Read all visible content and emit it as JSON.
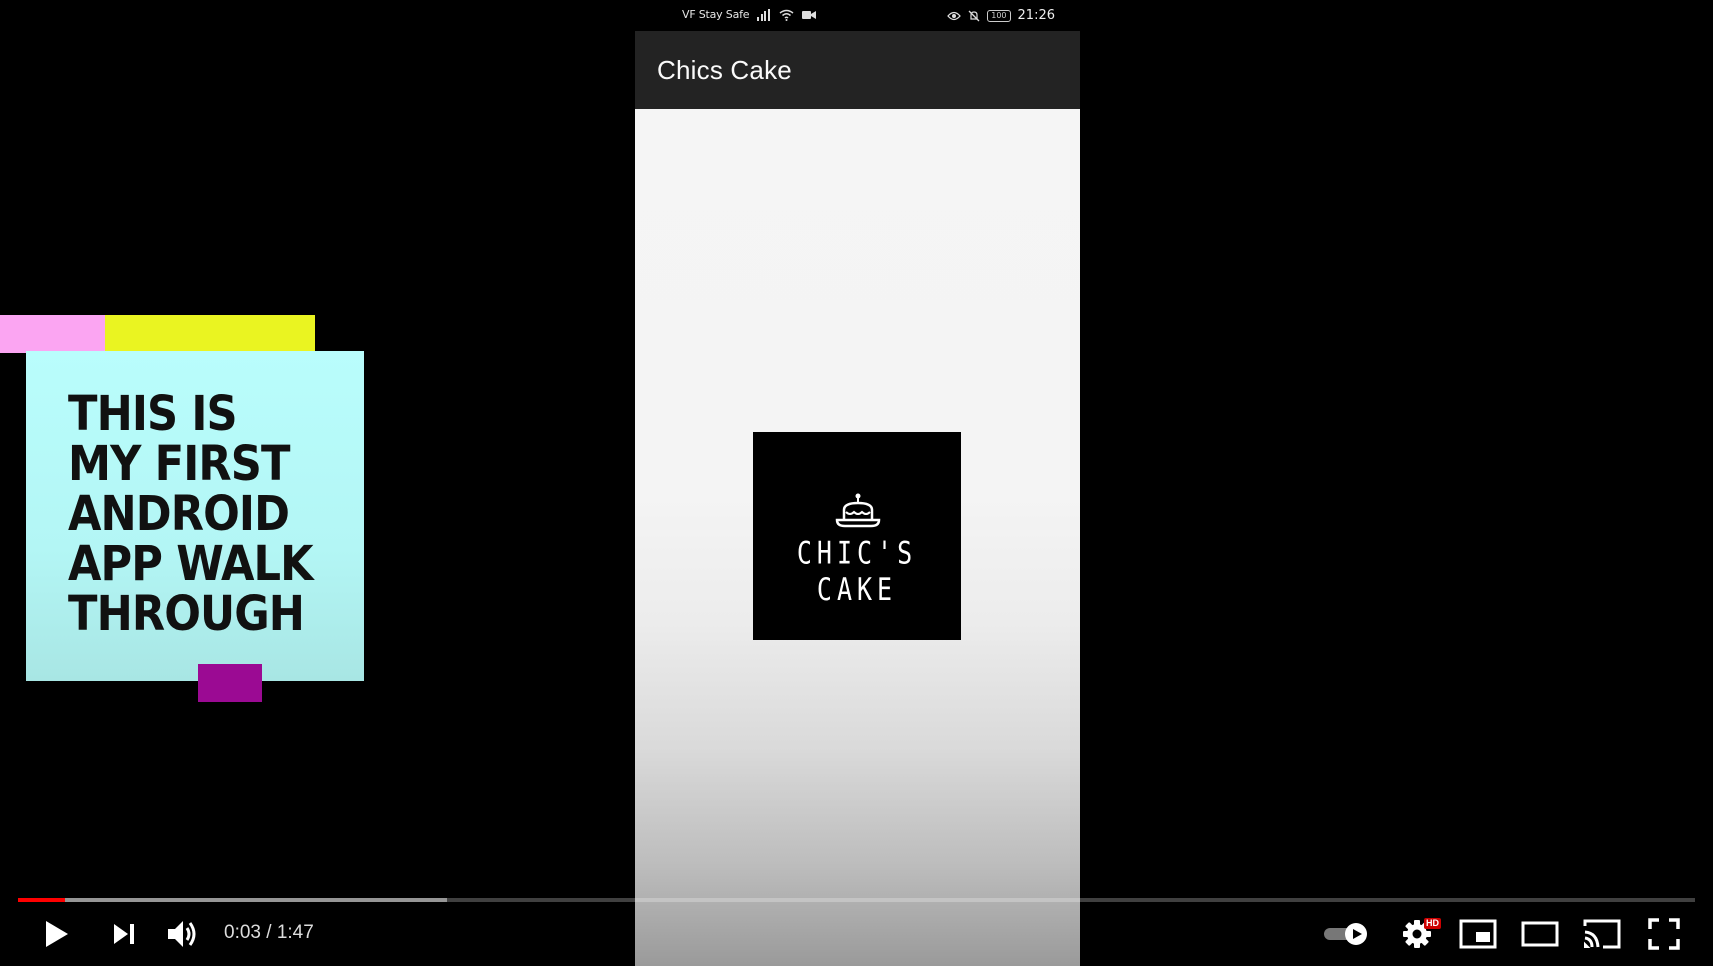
{
  "phone": {
    "status_bar": {
      "carrier": "VF Stay Safe",
      "battery": "100",
      "time": "21:26"
    },
    "app_bar": {
      "title": "Chics Cake"
    },
    "logo": {
      "text": "CHIC'S CAKE",
      "icon": "cake-icon"
    }
  },
  "overlay_note": {
    "lines": [
      "THIS IS",
      "MY FIRST",
      "ANDROID",
      "APP WALK",
      "THROUGH"
    ]
  },
  "player": {
    "current_time": "0:03",
    "duration": "1:47",
    "time_separator": "/",
    "played_fraction": 0.028,
    "buffered_fraction": 0.256,
    "quality_badge": "HD",
    "accent_color": "#ff0000",
    "icons": {
      "play": "play-icon",
      "next": "next-icon",
      "volume": "volume-icon",
      "autoplay": "autoplay-toggle-icon",
      "settings": "gear-icon",
      "miniplayer": "miniplayer-icon",
      "theater": "theater-mode-icon",
      "cast": "cast-icon",
      "fullscreen": "fullscreen-icon"
    }
  }
}
